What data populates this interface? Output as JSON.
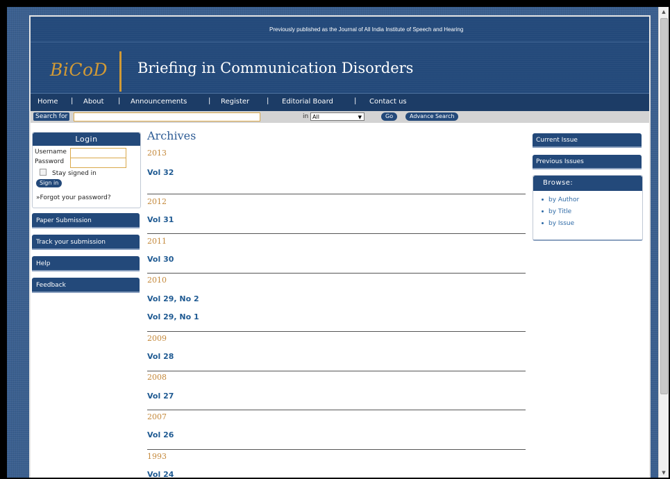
{
  "header": {
    "tagline": "Previously published as the Journal of All India Institute of Speech and Hearing",
    "logo": "BiCoD",
    "title": "Briefing in Communication Disorders"
  },
  "nav": {
    "items": [
      "Home",
      "About",
      "Announcements",
      "Register",
      "Editorial Board",
      "Contact us"
    ],
    "separator": "|"
  },
  "search": {
    "label": "Search for",
    "value": "",
    "in_label": "in",
    "scope": "All",
    "go": "Go",
    "advance": "Advance Search"
  },
  "login": {
    "title": "Login",
    "username_label": "Username",
    "password_label": "Password",
    "stay": "Stay signed in",
    "sign_in": "Sign in",
    "forgot": "»Forgot your password?"
  },
  "left_links": [
    "Paper Submission",
    "Track your submission",
    "Help",
    "Feedback"
  ],
  "main": {
    "title": "Archives",
    "years": [
      {
        "year": "2013",
        "vols": [
          "Vol 32"
        ]
      },
      {
        "year": "2012",
        "vols": [
          "Vol 31"
        ]
      },
      {
        "year": "2011",
        "vols": [
          "Vol 30"
        ]
      },
      {
        "year": "2010",
        "vols": [
          "Vol 29, No 2",
          "Vol 29, No 1"
        ]
      },
      {
        "year": "2009",
        "vols": [
          "Vol 28"
        ]
      },
      {
        "year": "2008",
        "vols": [
          "Vol 27"
        ]
      },
      {
        "year": "2007",
        "vols": [
          "Vol 26"
        ]
      },
      {
        "year": "1993",
        "vols": [
          "Vol 24"
        ]
      }
    ]
  },
  "right": {
    "current": "Current Issue",
    "previous": "Previous Issues",
    "browse_title": "Browse:",
    "browse_items": [
      "by Author",
      "by Title",
      "by Issue"
    ]
  },
  "icons": {
    "scroll_up": "triangle-up",
    "scroll_down": "triangle-down",
    "select_arrow": "triangle-down"
  }
}
